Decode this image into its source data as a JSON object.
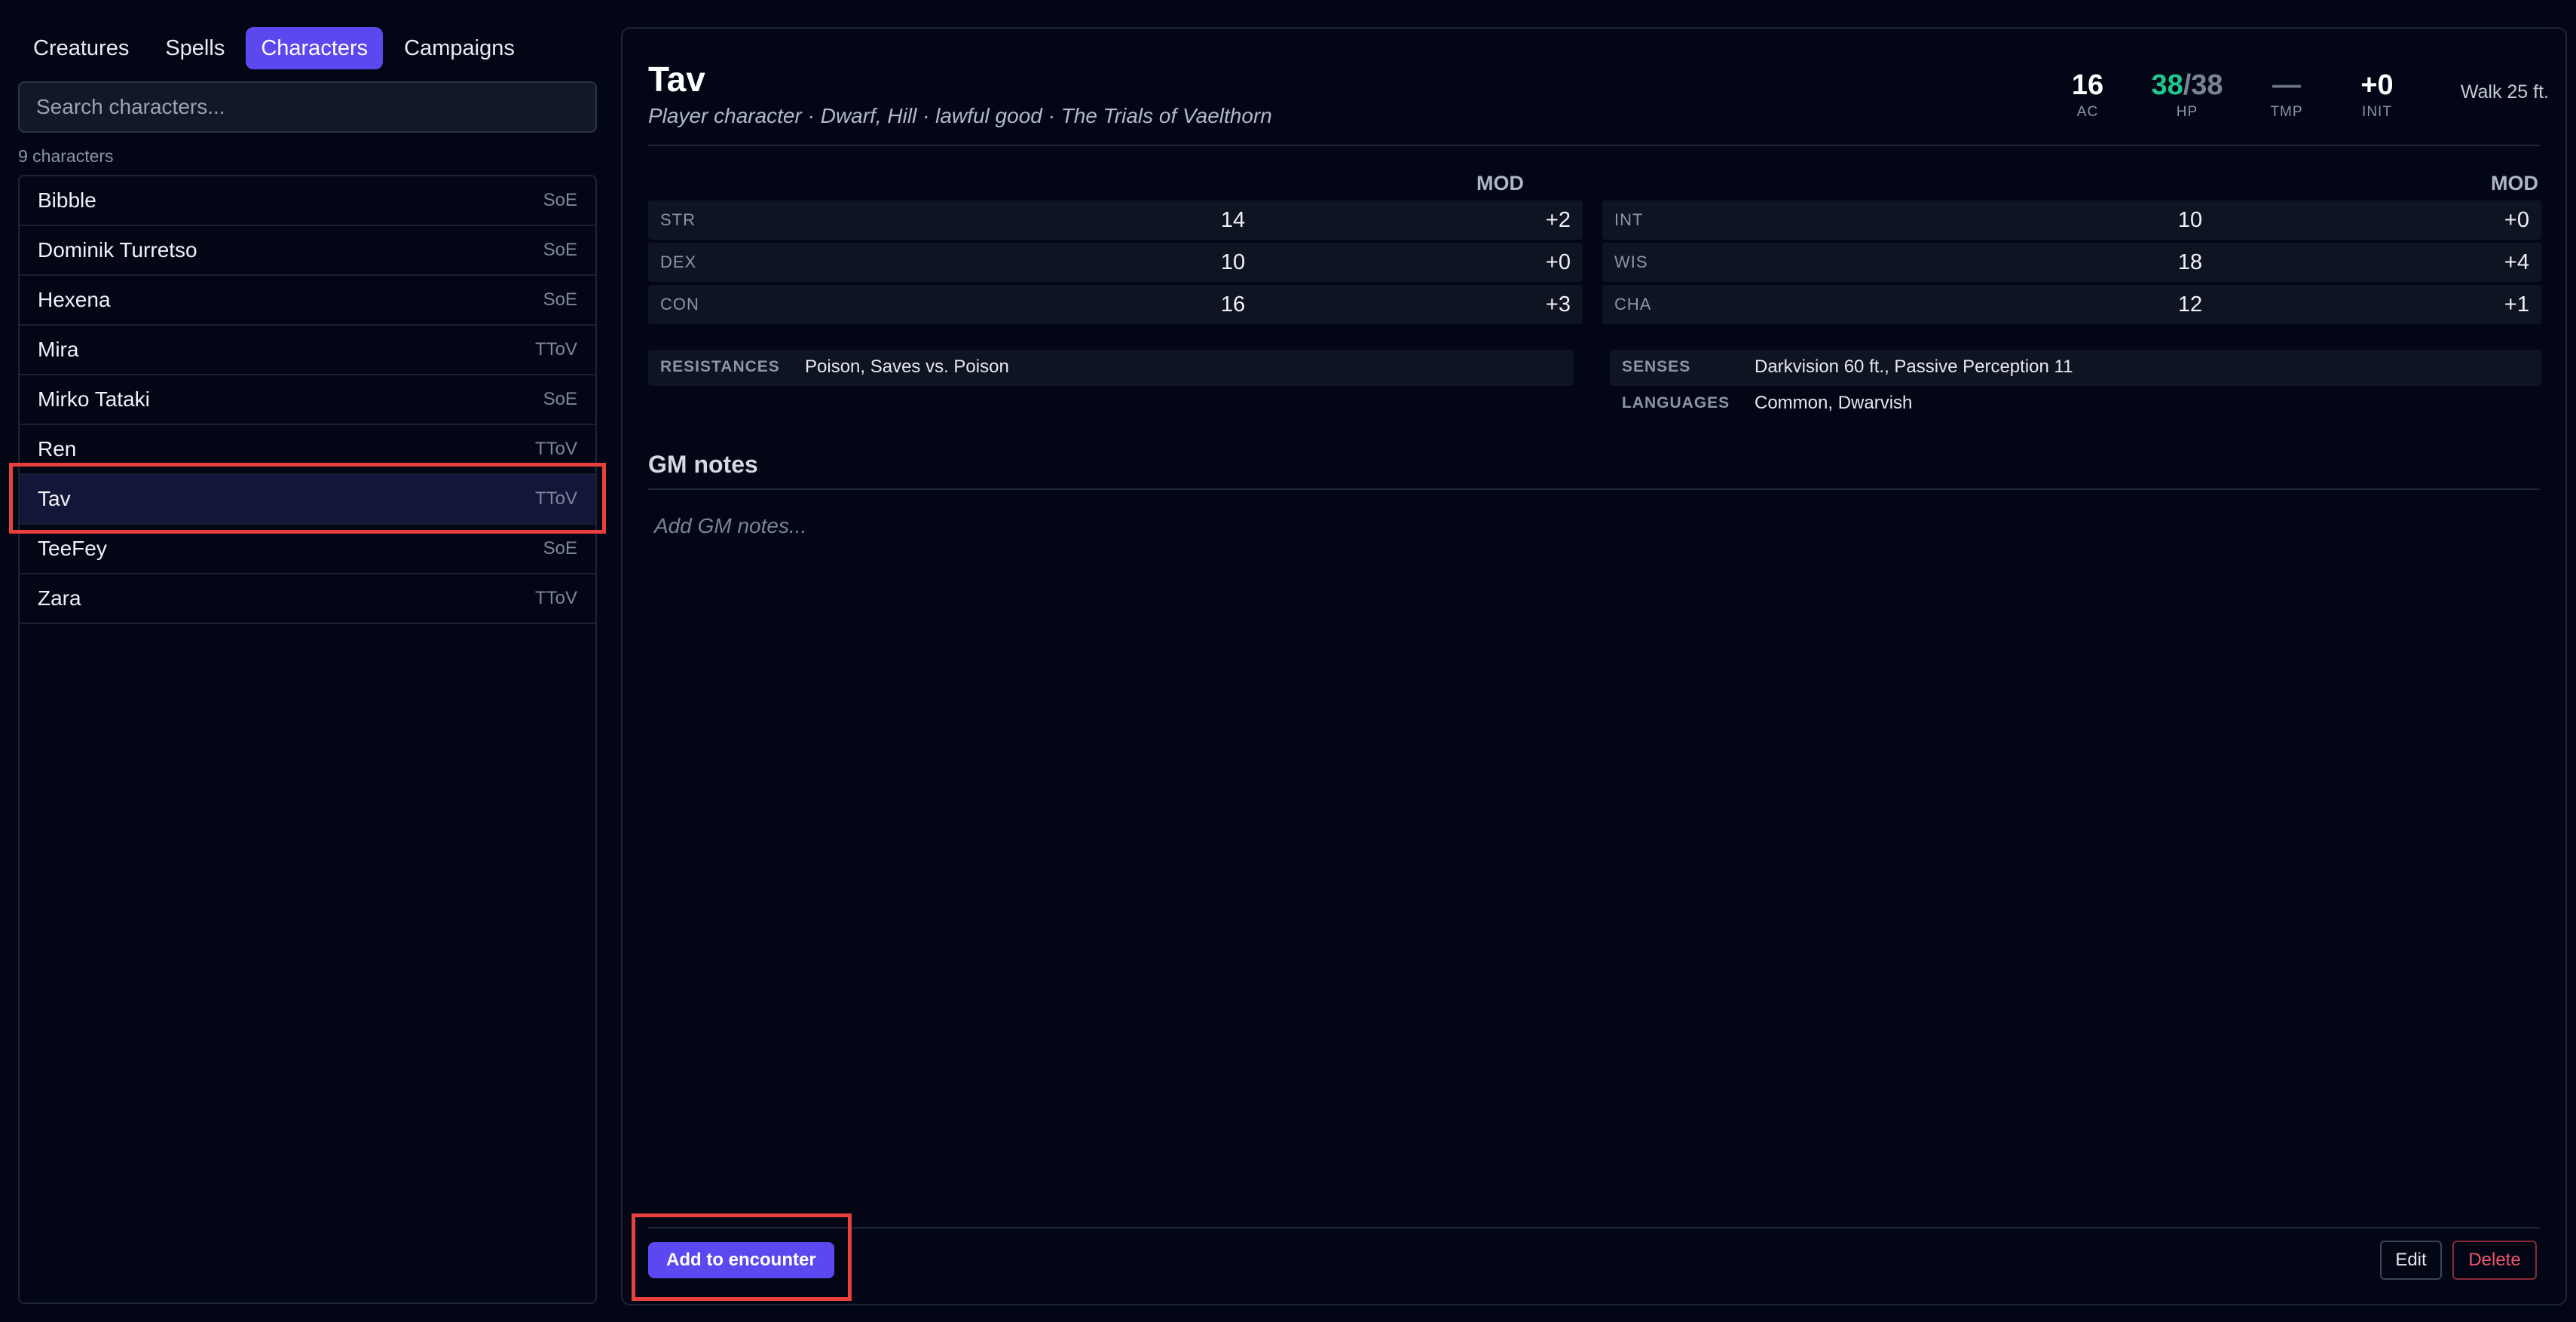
{
  "nav": {
    "tabs": [
      {
        "label": "Creatures",
        "active": false
      },
      {
        "label": "Spells",
        "active": false
      },
      {
        "label": "Characters",
        "active": true
      },
      {
        "label": "Campaigns",
        "active": false
      }
    ]
  },
  "search": {
    "placeholder": "Search characters...",
    "value": ""
  },
  "list": {
    "count_label": "9 characters",
    "items": [
      {
        "name": "Bibble",
        "campaign": "SoE"
      },
      {
        "name": "Dominik Turretso",
        "campaign": "SoE"
      },
      {
        "name": "Hexena",
        "campaign": "SoE"
      },
      {
        "name": "Mira",
        "campaign": "TToV"
      },
      {
        "name": "Mirko Tataki",
        "campaign": "SoE"
      },
      {
        "name": "Ren",
        "campaign": "TToV"
      },
      {
        "name": "Tav",
        "campaign": "TToV",
        "selected": true
      },
      {
        "name": "TeeFey",
        "campaign": "SoE"
      },
      {
        "name": "Zara",
        "campaign": "TToV"
      }
    ]
  },
  "character": {
    "name": "Tav",
    "subtitle": "Player character · Dwarf, Hill · lawful good · The Trials of Vaelthorn",
    "stats": {
      "ac": {
        "value": "16",
        "label": "AC"
      },
      "hp": {
        "current": "38",
        "sep": "/",
        "max": "38",
        "label": "HP"
      },
      "tmp": {
        "value": "—",
        "label": "TMP"
      },
      "init": {
        "value": "+0",
        "label": "INIT"
      },
      "speed": "Walk 25 ft."
    },
    "mod_header": "MOD",
    "abilities_left": [
      {
        "name": "STR",
        "score": "14",
        "mod": "+2"
      },
      {
        "name": "DEX",
        "score": "10",
        "mod": "+0"
      },
      {
        "name": "CON",
        "score": "16",
        "mod": "+3"
      }
    ],
    "abilities_right": [
      {
        "name": "INT",
        "score": "10",
        "mod": "+0"
      },
      {
        "name": "WIS",
        "score": "18",
        "mod": "+4"
      },
      {
        "name": "CHA",
        "score": "12",
        "mod": "+1"
      }
    ],
    "resistances": {
      "label": "RESISTANCES",
      "value": "Poison, Saves vs. Poison"
    },
    "senses": {
      "label": "SENSES",
      "value": "Darkvision 60 ft., Passive Perception 11"
    },
    "languages": {
      "label": "LANGUAGES",
      "value": "Common, Dwarvish"
    },
    "gm_notes": {
      "title": "GM notes",
      "placeholder": "Add GM notes...",
      "value": ""
    }
  },
  "actions": {
    "add_to_encounter": "Add to encounter",
    "edit": "Edit",
    "delete": "Delete"
  },
  "colors": {
    "accent": "#5b48ee",
    "hp_current": "#22c58b",
    "danger": "#f2556b",
    "background": "#030615"
  }
}
